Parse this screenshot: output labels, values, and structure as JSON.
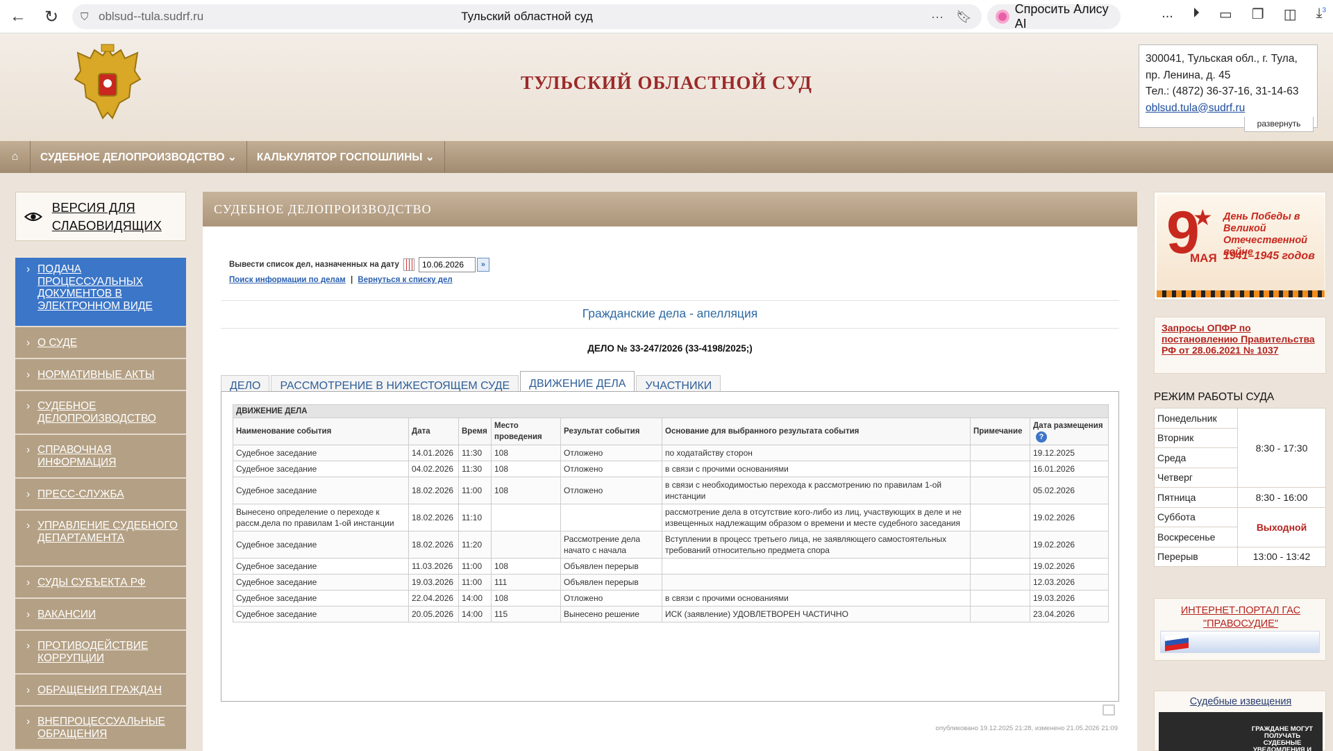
{
  "browser": {
    "url": "oblsud--tula.sudrf.ru",
    "tab_title": "Тульский областной суд",
    "alice_label": "Спросить Алису AI",
    "more_label": "···",
    "menu_label": "...",
    "downloads_badge": "3"
  },
  "header": {
    "site_title": "ТУЛЬСКИЙ ОБЛАСТНОЙ СУД",
    "address_line1": "300041, Тульская обл., г. Тула,",
    "address_line2": "пр. Ленина, д. 45",
    "phone": "Тел.: (4872) 36-37-16, 31-14-63",
    "email": "oblsud.tula@sudrf.ru",
    "expand_label": "развернуть"
  },
  "topnav": {
    "items": [
      "СУДЕБНОЕ ДЕЛОПРОИЗВОДСТВО ⌄",
      "КАЛЬКУЛЯТОР ГОСПОШЛИНЫ ⌄"
    ]
  },
  "sidebar": {
    "accessibility_label": "ВЕРСИЯ ДЛЯ СЛАБОВИДЯЩИХ",
    "items": [
      "ПОДАЧА ПРОЦЕССУАЛЬНЫХ ДОКУМЕНТОВ В ЭЛЕКТРОННОМ ВИДЕ",
      "О СУДЕ",
      "НОРМАТИВНЫЕ АКТЫ",
      "СУДЕБНОЕ ДЕЛОПРОИЗВОДСТВО",
      "СПРАВОЧНАЯ ИНФОРМАЦИЯ",
      "ПРЕСС-СЛУЖБА",
      "УПРАВЛЕНИЕ СУДЕБНОГО ДЕПАРТАМЕНТА",
      "СУДЫ СУБЪЕКТА РФ",
      "ВАКАНСИИ",
      "ПРОТИВОДЕЙСТВИЕ КОРРУПЦИИ",
      "ОБРАЩЕНИЯ ГРАЖДАН",
      "ВНЕПРОЦЕССУАЛЬНЫЕ ОБРАЩЕНИЯ"
    ]
  },
  "main": {
    "heading": "СУДЕБНОЕ ДЕЛОПРОИЗВОДСТВО",
    "date_label": "Вывести список дел, назначенных на дату",
    "date_value": "10.06.2026",
    "go_symbol": "»",
    "link_search": "Поиск информации по делам",
    "link_separator": "|",
    "link_back": "Вернуться к списку дел",
    "section_title": "Гражданские дела - апелляция",
    "case_title": "ДЕЛО № 33-247/2026 (33-4198/2025;)",
    "tabs": [
      "ДЕЛО",
      "РАССМОТРЕНИЕ В НИЖЕСТОЯЩЕМ СУДЕ",
      "ДВИЖЕНИЕ ДЕЛА",
      "УЧАСТНИКИ"
    ],
    "table_caption": "ДВИЖЕНИЕ ДЕЛА",
    "columns": [
      "Наименование события",
      "Дата",
      "Время",
      "Место проведения",
      "Результат события",
      "Основание для выбранного результата события",
      "Примечание",
      "Дата размещения"
    ],
    "help_symbol": "?",
    "rows": [
      [
        "Судебное заседание",
        "14.01.2026",
        "11:30",
        "108",
        "Отложено",
        "по ходатайству сторон",
        "",
        "19.12.2025"
      ],
      [
        "Судебное заседание",
        "04.02.2026",
        "11:30",
        "108",
        "Отложено",
        "в связи с прочими основаниями",
        "",
        "16.01.2026"
      ],
      [
        "Судебное заседание",
        "18.02.2026",
        "11:00",
        "108",
        "Отложено",
        "в связи с необходимостью перехода к рассмотрению по правилам 1-ой инстанции",
        "",
        "05.02.2026"
      ],
      [
        "Вынесено определение о переходе к рассм.дела по правилам 1-ой инстанции",
        "18.02.2026",
        "11:10",
        "",
        "",
        "рассмотрение дела в отсутствие кого-либо из лиц, участвующих в деле и не извещенных надлежащим образом о времени и месте судебного заседания",
        "",
        "19.02.2026"
      ],
      [
        "Судебное заседание",
        "18.02.2026",
        "11:20",
        "",
        "Рассмотрение дела начато с начала",
        "Вступлении в процесс третьего лица, не заявляющего самостоятельных требований относительно предмета спора",
        "",
        "19.02.2026"
      ],
      [
        "Судебное заседание",
        "11.03.2026",
        "11:00",
        "108",
        "Объявлен перерыв",
        "",
        "",
        "19.02.2026"
      ],
      [
        "Судебное заседание",
        "19.03.2026",
        "11:00",
        "111",
        "Объявлен перерыв",
        "",
        "",
        "12.03.2026"
      ],
      [
        "Судебное заседание",
        "22.04.2026",
        "14:00",
        "108",
        "Отложено",
        "в связи с прочими основаниями",
        "",
        "19.03.2026"
      ],
      [
        "Судебное заседание",
        "20.05.2026",
        "14:00",
        "115",
        "Вынесено решение",
        "ИСК (заявление) УДОВЛЕТВОРЕН ЧАСТИЧНО",
        "",
        "23.04.2026"
      ]
    ],
    "published": "опубликовано 19.12.2025 21:28, изменено 21.05.2026 21:09"
  },
  "right": {
    "victory_nine": "9",
    "victory_may": "МАЯ",
    "victory_text": "День Победы в Великой Отечественной войне",
    "victory_years": "1941–1945 годов",
    "opfr_link": "Запросы ОПФР по постановлению Правительства РФ от 28.06.2021 № 1037",
    "schedule_title": "РЕЖИМ РАБОТЫ СУДА",
    "schedule": {
      "mon": "Понедельник",
      "tue": "Вторник",
      "wed": "Среда",
      "thu": "Четверг",
      "fri": "Пятница",
      "sat": "Суббота",
      "sun": "Воскресенье",
      "break": "Перерыв",
      "weekday_hours": "8:30 - 17:30",
      "friday_hours": "8:30 - 16:00",
      "weekend": "Выходной",
      "break_hours": "13:00 - 13:42"
    },
    "portal_title": "ИНТЕРНЕТ-ПОРТАЛ ГАС \"ПРАВОСУДИЕ\"",
    "notice_title": "Судебные извещения",
    "notice_text": "ГРАЖДАНЕ МОГУТ ПОЛУЧАТЬ СУДЕБНЫЕ УВЕДОМЛЕНИЯ И КОПИИ СУДЕБНЫХ АКТОВ"
  },
  "colors": {
    "accent_brown": "#ab957a",
    "title_red": "#9c2a2a",
    "link_blue": "#2a5fb0",
    "active_menu": "#3b76c8"
  }
}
